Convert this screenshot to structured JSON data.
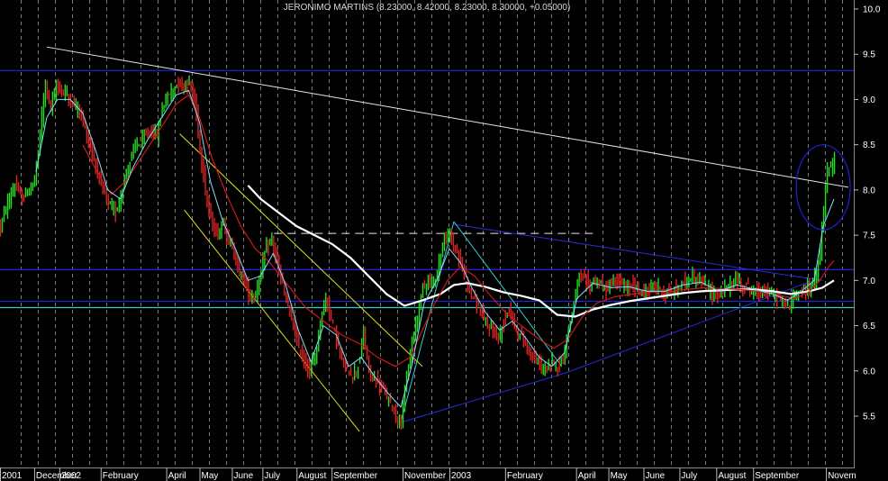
{
  "chart_data": {
    "type": "candlestick",
    "title": "JERONIMO MARTINS (8.23000, 8.42000, 8.23000, 8.30000, +0.05000)",
    "ylim": [
      5.2,
      10.05
    ],
    "xlim": [
      0,
      950
    ],
    "y_ticks": [
      5.5,
      6.0,
      6.5,
      7.0,
      7.5,
      8.0,
      8.5,
      9.0,
      9.5,
      10.0
    ],
    "y_tick_labels": [
      "5.5",
      "6.0",
      "6.5",
      "7.0",
      "7.5",
      "8.0",
      "8.5",
      "9.0",
      "9.5",
      "10.0"
    ],
    "x_ticks": [
      {
        "label": "2001",
        "x": 0
      },
      {
        "label": "December",
        "x": 38
      },
      {
        "label": "2002",
        "x": 66
      },
      {
        "label": "February",
        "x": 112
      },
      {
        "label": "April",
        "x": 185
      },
      {
        "label": "May",
        "x": 222
      },
      {
        "label": "June",
        "x": 258
      },
      {
        "label": "July",
        "x": 292
      },
      {
        "label": "August",
        "x": 330
      },
      {
        "label": "September",
        "x": 369
      },
      {
        "label": "November",
        "x": 448
      },
      {
        "label": "2003",
        "x": 500
      },
      {
        "label": "February",
        "x": 562
      },
      {
        "label": "April",
        "x": 641
      },
      {
        "label": "May",
        "x": 677
      },
      {
        "label": "June",
        "x": 716
      },
      {
        "label": "July",
        "x": 756
      },
      {
        "label": "August",
        "x": 797
      },
      {
        "label": "September",
        "x": 838
      },
      {
        "label": "Novem",
        "x": 919
      }
    ],
    "close_path": [
      [
        0,
        7.6
      ],
      [
        8,
        7.85
      ],
      [
        16,
        8.05
      ],
      [
        24,
        7.9
      ],
      [
        32,
        8.0
      ],
      [
        38,
        8.1
      ],
      [
        44,
        8.6
      ],
      [
        50,
        9.2
      ],
      [
        56,
        8.9
      ],
      [
        62,
        9.15
      ],
      [
        68,
        9.1
      ],
      [
        74,
        9.05
      ],
      [
        80,
        8.95
      ],
      [
        88,
        8.9
      ],
      [
        96,
        8.6
      ],
      [
        104,
        8.35
      ],
      [
        112,
        8.05
      ],
      [
        120,
        7.85
      ],
      [
        128,
        7.75
      ],
      [
        134,
        7.95
      ],
      [
        142,
        8.25
      ],
      [
        150,
        8.5
      ],
      [
        158,
        8.55
      ],
      [
        166,
        8.65
      ],
      [
        174,
        8.6
      ],
      [
        180,
        8.9
      ],
      [
        186,
        9.05
      ],
      [
        192,
        9.1
      ],
      [
        198,
        9.2
      ],
      [
        204,
        9.15
      ],
      [
        210,
        9.2
      ],
      [
        214,
        9.05
      ],
      [
        218,
        8.85
      ],
      [
        224,
        8.3
      ],
      [
        230,
        7.85
      ],
      [
        236,
        7.6
      ],
      [
        242,
        7.5
      ],
      [
        248,
        7.65
      ],
      [
        254,
        7.45
      ],
      [
        260,
        7.3
      ],
      [
        266,
        7.1
      ],
      [
        272,
        7.0
      ],
      [
        278,
        6.8
      ],
      [
        284,
        6.85
      ],
      [
        290,
        7.1
      ],
      [
        296,
        7.35
      ],
      [
        302,
        7.45
      ],
      [
        308,
        7.2
      ],
      [
        314,
        6.95
      ],
      [
        320,
        6.7
      ],
      [
        326,
        6.5
      ],
      [
        332,
        6.25
      ],
      [
        338,
        6.1
      ],
      [
        344,
        6.0
      ],
      [
        350,
        6.15
      ],
      [
        356,
        6.55
      ],
      [
        362,
        6.8
      ],
      [
        368,
        6.6
      ],
      [
        374,
        6.35
      ],
      [
        380,
        6.1
      ],
      [
        386,
        6.0
      ],
      [
        392,
        5.95
      ],
      [
        398,
        6.05
      ],
      [
        404,
        6.4
      ],
      [
        410,
        6.0
      ],
      [
        416,
        5.9
      ],
      [
        422,
        5.85
      ],
      [
        428,
        5.75
      ],
      [
        434,
        5.65
      ],
      [
        440,
        5.5
      ],
      [
        446,
        5.45
      ],
      [
        452,
        5.9
      ],
      [
        458,
        6.3
      ],
      [
        464,
        6.6
      ],
      [
        470,
        6.95
      ],
      [
        476,
        7.0
      ],
      [
        482,
        6.95
      ],
      [
        488,
        7.2
      ],
      [
        494,
        7.45
      ],
      [
        500,
        7.5
      ],
      [
        506,
        7.35
      ],
      [
        512,
        7.2
      ],
      [
        518,
        7.05
      ],
      [
        524,
        6.85
      ],
      [
        530,
        6.75
      ],
      [
        536,
        6.6
      ],
      [
        542,
        6.5
      ],
      [
        548,
        6.45
      ],
      [
        554,
        6.35
      ],
      [
        560,
        6.55
      ],
      [
        566,
        6.7
      ],
      [
        572,
        6.5
      ],
      [
        578,
        6.4
      ],
      [
        584,
        6.3
      ],
      [
        590,
        6.2
      ],
      [
        596,
        6.1
      ],
      [
        602,
        6.05
      ],
      [
        608,
        6.0
      ],
      [
        614,
        6.1
      ],
      [
        620,
        6.05
      ],
      [
        626,
        6.15
      ],
      [
        632,
        6.45
      ],
      [
        638,
        6.75
      ],
      [
        644,
        7.05
      ],
      [
        650,
        7.0
      ],
      [
        656,
        6.95
      ],
      [
        662,
        7.0
      ],
      [
        668,
        6.95
      ],
      [
        674,
        6.9
      ],
      [
        680,
        6.95
      ],
      [
        686,
        7.0
      ],
      [
        692,
        6.95
      ],
      [
        698,
        6.9
      ],
      [
        704,
        6.95
      ],
      [
        710,
        6.9
      ],
      [
        716,
        6.85
      ],
      [
        722,
        6.9
      ],
      [
        728,
        6.95
      ],
      [
        734,
        6.9
      ],
      [
        740,
        6.85
      ],
      [
        746,
        6.85
      ],
      [
        752,
        6.9
      ],
      [
        758,
        6.95
      ],
      [
        764,
        7.0
      ],
      [
        770,
        7.05
      ],
      [
        776,
        7.0
      ],
      [
        782,
        6.95
      ],
      [
        788,
        6.9
      ],
      [
        794,
        6.85
      ],
      [
        800,
        6.85
      ],
      [
        806,
        6.9
      ],
      [
        812,
        6.95
      ],
      [
        818,
        7.0
      ],
      [
        824,
        6.95
      ],
      [
        830,
        6.95
      ],
      [
        836,
        6.9
      ],
      [
        842,
        6.85
      ],
      [
        848,
        6.9
      ],
      [
        854,
        6.85
      ],
      [
        860,
        6.85
      ],
      [
        866,
        6.8
      ],
      [
        872,
        6.75
      ],
      [
        878,
        6.7
      ],
      [
        884,
        6.85
      ],
      [
        890,
        6.9
      ],
      [
        896,
        6.9
      ],
      [
        902,
        6.95
      ],
      [
        908,
        7.05
      ],
      [
        912,
        7.3
      ],
      [
        916,
        7.8
      ],
      [
        920,
        8.2
      ],
      [
        924,
        8.25
      ],
      [
        928,
        8.3
      ]
    ],
    "moving_averages": [
      {
        "color": "#ffffff",
        "width": 2.2,
        "points": [
          [
            276,
            8.05
          ],
          [
            290,
            7.9
          ],
          [
            310,
            7.75
          ],
          [
            330,
            7.6
          ],
          [
            350,
            7.5
          ],
          [
            370,
            7.4
          ],
          [
            390,
            7.25
          ],
          [
            410,
            7.05
          ],
          [
            430,
            6.85
          ],
          [
            450,
            6.72
          ],
          [
            470,
            6.78
          ],
          [
            490,
            6.85
          ],
          [
            505,
            6.95
          ],
          [
            520,
            6.97
          ],
          [
            540,
            6.93
          ],
          [
            560,
            6.87
          ],
          [
            580,
            6.83
          ],
          [
            600,
            6.78
          ],
          [
            620,
            6.62
          ],
          [
            640,
            6.6
          ],
          [
            660,
            6.68
          ],
          [
            680,
            6.73
          ],
          [
            700,
            6.77
          ],
          [
            720,
            6.8
          ],
          [
            740,
            6.83
          ],
          [
            760,
            6.86
          ],
          [
            780,
            6.88
          ],
          [
            800,
            6.89
          ],
          [
            820,
            6.9
          ],
          [
            840,
            6.9
          ],
          [
            860,
            6.88
          ],
          [
            880,
            6.85
          ],
          [
            900,
            6.88
          ],
          [
            915,
            6.92
          ],
          [
            928,
            7.0
          ]
        ]
      },
      {
        "color": "#d01818",
        "width": 1.2,
        "points": [
          [
            92,
            8.5
          ],
          [
            108,
            8.2
          ],
          [
            124,
            7.95
          ],
          [
            140,
            8.1
          ],
          [
            160,
            8.4
          ],
          [
            180,
            8.7
          ],
          [
            196,
            8.95
          ],
          [
            210,
            9.05
          ],
          [
            222,
            8.8
          ],
          [
            236,
            8.35
          ],
          [
            252,
            7.95
          ],
          [
            268,
            7.6
          ],
          [
            284,
            7.35
          ],
          [
            300,
            7.2
          ],
          [
            320,
            6.95
          ],
          [
            340,
            6.7
          ],
          [
            360,
            6.55
          ],
          [
            380,
            6.4
          ],
          [
            400,
            6.3
          ],
          [
            420,
            6.15
          ],
          [
            440,
            6.05
          ],
          [
            456,
            6.15
          ],
          [
            470,
            6.45
          ],
          [
            484,
            6.75
          ],
          [
            498,
            7.0
          ],
          [
            512,
            7.15
          ],
          [
            528,
            7.05
          ],
          [
            544,
            6.85
          ],
          [
            562,
            6.65
          ],
          [
            580,
            6.5
          ],
          [
            600,
            6.35
          ],
          [
            616,
            6.25
          ],
          [
            632,
            6.35
          ],
          [
            648,
            6.6
          ],
          [
            664,
            6.75
          ],
          [
            684,
            6.82
          ],
          [
            704,
            6.85
          ],
          [
            724,
            6.87
          ],
          [
            744,
            6.88
          ],
          [
            764,
            6.9
          ],
          [
            784,
            6.92
          ],
          [
            804,
            6.91
          ],
          [
            824,
            6.9
          ],
          [
            844,
            6.88
          ],
          [
            864,
            6.84
          ],
          [
            884,
            6.8
          ],
          [
            900,
            6.87
          ],
          [
            912,
            7.0
          ],
          [
            922,
            7.15
          ],
          [
            928,
            7.22
          ]
        ]
      },
      {
        "color": "#7fdfff",
        "width": 1.0,
        "points": [
          [
            40,
            8.2
          ],
          [
            52,
            8.8
          ],
          [
            64,
            9.0
          ],
          [
            78,
            9.0
          ],
          [
            92,
            8.85
          ],
          [
            106,
            8.45
          ],
          [
            120,
            8.0
          ],
          [
            134,
            7.9
          ],
          [
            148,
            8.25
          ],
          [
            164,
            8.55
          ],
          [
            180,
            8.8
          ],
          [
            196,
            9.05
          ],
          [
            210,
            9.1
          ],
          [
            222,
            8.75
          ],
          [
            234,
            8.1
          ],
          [
            248,
            7.65
          ],
          [
            262,
            7.35
          ],
          [
            276,
            7.0
          ],
          [
            290,
            7.05
          ],
          [
            304,
            7.3
          ],
          [
            318,
            6.95
          ],
          [
            332,
            6.45
          ],
          [
            346,
            6.1
          ],
          [
            360,
            6.5
          ],
          [
            374,
            6.4
          ],
          [
            388,
            6.05
          ],
          [
            402,
            6.15
          ],
          [
            416,
            5.95
          ],
          [
            432,
            5.75
          ],
          [
            446,
            5.6
          ],
          [
            458,
            6.05
          ],
          [
            472,
            6.75
          ],
          [
            486,
            7.0
          ],
          [
            500,
            7.35
          ],
          [
            512,
            7.2
          ],
          [
            526,
            6.9
          ],
          [
            540,
            6.65
          ],
          [
            556,
            6.45
          ],
          [
            570,
            6.55
          ],
          [
            586,
            6.35
          ],
          [
            600,
            6.15
          ],
          [
            614,
            6.05
          ],
          [
            628,
            6.2
          ],
          [
            642,
            6.8
          ],
          [
            660,
            6.97
          ],
          [
            680,
            6.92
          ],
          [
            700,
            6.93
          ],
          [
            720,
            6.88
          ],
          [
            740,
            6.88
          ],
          [
            760,
            6.95
          ],
          [
            780,
            6.98
          ],
          [
            800,
            6.88
          ],
          [
            820,
            6.95
          ],
          [
            840,
            6.9
          ],
          [
            860,
            6.85
          ],
          [
            876,
            6.78
          ],
          [
            892,
            6.88
          ],
          [
            906,
            7.0
          ],
          [
            916,
            7.6
          ],
          [
            928,
            7.9
          ]
        ]
      }
    ],
    "h_lines": [
      {
        "y": 9.32,
        "color": "#2424e0"
      },
      {
        "y": 7.12,
        "color": "#2424e0"
      },
      {
        "y": 6.77,
        "color": "#2424e0"
      },
      {
        "y": 6.7,
        "color": "#30d0d0"
      }
    ],
    "trend_lines": [
      {
        "color": "#e8e8e8",
        "from": [
          52,
          9.58
        ],
        "to": [
          944,
          8.03
        ],
        "dash": false
      },
      {
        "color": "#e8e8e8",
        "from": [
          305,
          7.52
        ],
        "to": [
          660,
          7.52
        ],
        "dash": true
      },
      {
        "color": "#2a2adf",
        "from": [
          446,
          5.43
        ],
        "to": [
          630,
          5.98
        ],
        "dash": false
      },
      {
        "color": "#2a2adf",
        "from": [
          630,
          5.98
        ],
        "to": [
          905,
          7.0
        ],
        "dash": false
      },
      {
        "color": "#2a2adf",
        "from": [
          505,
          7.62
        ],
        "to": [
          915,
          7.0
        ],
        "dash": false
      },
      {
        "color": "#30d0d0",
        "from": [
          446,
          5.43
        ],
        "to": [
          505,
          7.65
        ],
        "dash": false
      },
      {
        "color": "#30d0d0",
        "from": [
          505,
          7.65
        ],
        "to": [
          625,
          6.05
        ],
        "dash": false
      },
      {
        "color": "#e0e020",
        "from": [
          205,
          7.78
        ],
        "to": [
          400,
          5.33
        ],
        "dash": false
      },
      {
        "color": "#e0e020",
        "from": [
          200,
          8.62
        ],
        "to": [
          470,
          6.05
        ],
        "dash": false
      }
    ],
    "circle": {
      "cx": 916,
      "cy": 8.03,
      "rx": 30,
      "ry_value": 0.47,
      "color": "#2020d0"
    },
    "grid": true
  }
}
